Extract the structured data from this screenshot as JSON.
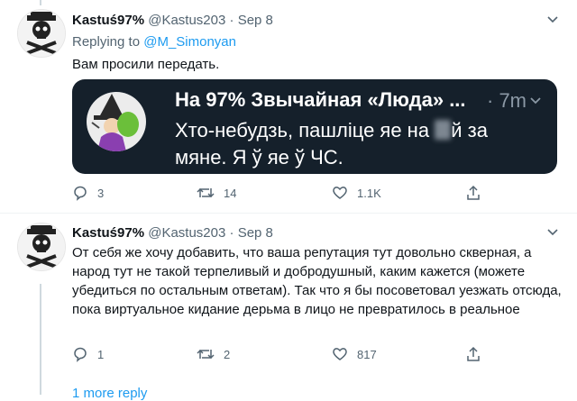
{
  "tweets": [
    {
      "name": "Kastuś97%",
      "handle": "@Kastus203",
      "dot": "·",
      "date": "Sep 8",
      "replying_label": "Replying to",
      "replying_to": "@M_Simonyan",
      "text": "Вам просили передать.",
      "embed": {
        "name": "На 97% Звычайная «Люда» ...",
        "time": "· 7m",
        "text_before": "Хто-небудзь, пашліце яе на",
        "text_after": "й за мяне. Я ў яе ў ЧС."
      },
      "actions": {
        "replies": "3",
        "retweets": "14",
        "likes": "1.1K"
      }
    },
    {
      "name": "Kastuś97%",
      "handle": "@Kastus203",
      "dot": "·",
      "date": "Sep 8",
      "text": "От себя же хочу добавить, что ваша репутация тут довольно скверная, а народ тут не такой терпеливый и добродушный, каким кажется (можете убедиться по остальным ответам). Так что я бы посоветовал уезжать отсюда, пока виртуальное кидание дерьма в лицо не превратилось в реальное",
      "actions": {
        "replies": "1",
        "retweets": "2",
        "likes": "817"
      }
    }
  ],
  "more_replies": "1 more reply",
  "colors": {
    "accent": "#1d9bf0",
    "muted": "#536471",
    "embed_bg": "#15202b"
  }
}
